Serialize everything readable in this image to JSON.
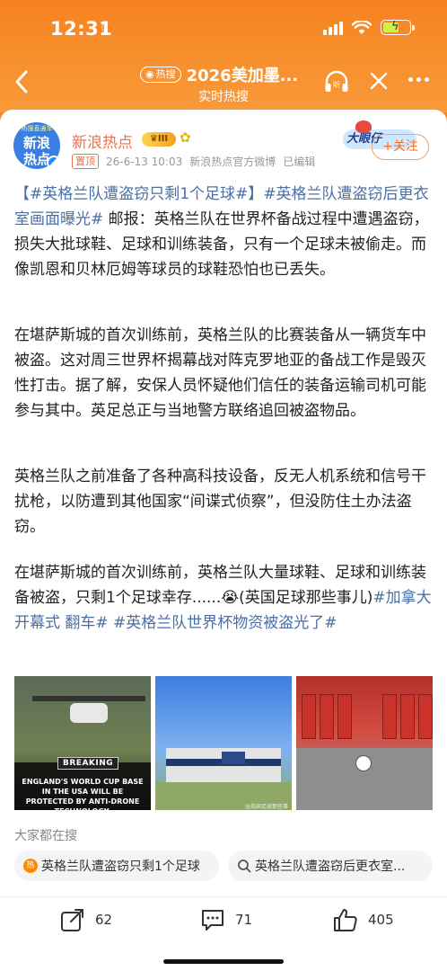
{
  "status_bar": {
    "time": "12:31"
  },
  "nav": {
    "hot_badge": "热搜",
    "title": "2026美加墨...",
    "subtitle": "实时热搜"
  },
  "post": {
    "avatar_line1": "新浪",
    "avatar_line2": "热点",
    "avatar_top": "热搜直通车",
    "author": "新浪热点",
    "level_badge": "III",
    "pinned_label": "置顶",
    "timestamp": "26-6-13 10:03",
    "source": "新浪热点官方微博",
    "edited": "已编辑",
    "decoration_label": "大眼仔",
    "follow_label": "+关注",
    "paragraphs": {
      "p1": {
        "tag1": "【#英格兰队遭盗窃只剩1个足球#】",
        "tag2": "#英格兰队遭盗窃后更衣室画面曝光#",
        "text": " 邮报：英格兰队在世界杯备战过程中遭遇盗窃，损失大批球鞋、足球和训练装备，只有一个足球未被偷走。而像凯恩和贝林厄姆等球员的球鞋恐怕也已丢失。"
      },
      "p2": "在堪萨斯城的首次训练前，英格兰队的比赛装备从一辆货车中被盗。这对周三世界杯揭幕战对阵克罗地亚的备战工作是毁灭性打击。据了解，安保人员怀疑他们信任的装备运输司机可能参与其中。英足总正与当地警方联络追回被盗物品。",
      "p3": "英格兰队之前准备了各种高科技设备，反无人机系统和信号干扰枪，以防遭到其他国家“间谍式侦察”，但没防住土办法盗窃。",
      "p4": {
        "text": "在堪萨斯城的首次训练前，英格兰队大量球鞋、足球和训练装备被盗，只剩1个足球幸存......😭(英国足球那些事儿)",
        "tag1": "#加拿大开幕式 翻车#",
        "tag2": " #英格兰队世界杯物资被盗光了#"
      }
    },
    "photos": {
      "photo1_breaking": "BREAKING",
      "photo1_caption": "ENGLAND'S WORLD CUP BASE IN THE USA WILL BE PROTECTED BY ANTI-DRONE TECHNOLOGY.",
      "photo2_watermark": "@英国足球那些事儿"
    }
  },
  "search_section": {
    "label": "大家都在搜",
    "chips": [
      {
        "text": "英格兰队遭盗窃只剩1个足球",
        "icon": "hot-icon"
      },
      {
        "text": "英格兰队遭盗窃后更衣室...",
        "icon": "search-icon"
      }
    ]
  },
  "actions": {
    "repost_count": "62",
    "comment_count": "71",
    "like_count": "405"
  },
  "colors": {
    "header_orange": "#f5831f",
    "author_orange": "#eb7350",
    "tag_blue": "#4a6fa5"
  }
}
